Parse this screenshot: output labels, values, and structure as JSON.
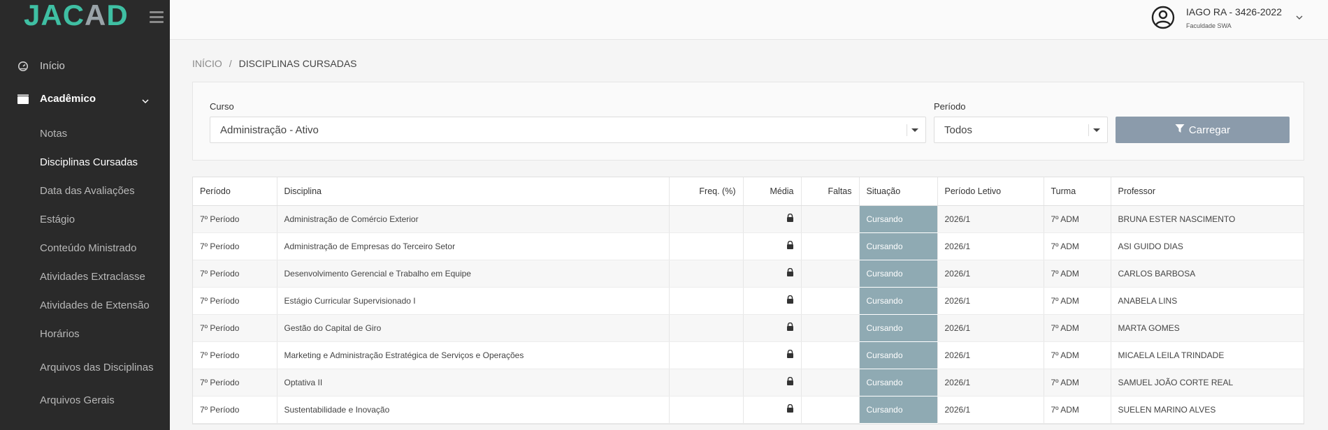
{
  "app": {
    "logo_part1": "JAC",
    "logo_part2": "A",
    "logo_part3": "D"
  },
  "sidebar": {
    "items": [
      {
        "label": "Início",
        "icon": "dashboard-icon"
      },
      {
        "label": "Acadêmico",
        "icon": "folder-icon",
        "expanded": true
      }
    ],
    "sub_items": [
      {
        "label": "Notas"
      },
      {
        "label": "Disciplinas Cursadas",
        "active": true
      },
      {
        "label": "Data das Avaliações"
      },
      {
        "label": "Estágio"
      },
      {
        "label": "Conteúdo Ministrado"
      },
      {
        "label": "Atividades Extraclasse"
      },
      {
        "label": "Atividades de Extensão"
      },
      {
        "label": "Horários"
      },
      {
        "label": "Arquivos das Disciplinas"
      },
      {
        "label": "Arquivos Gerais"
      }
    ]
  },
  "user": {
    "name": "IAGO RA - 3426-2022",
    "faculty": "Faculdade SWA"
  },
  "breadcrumb": {
    "home": "INÍCIO",
    "separator": "/",
    "current": "DISCIPLINAS CURSADAS"
  },
  "filters": {
    "curso_label": "Curso",
    "curso_value": "Administração - Ativo",
    "periodo_label": "Período",
    "periodo_value": "Todos",
    "load_button": "Carregar"
  },
  "table": {
    "headers": [
      "Período",
      "Disciplina",
      "Freq. (%)",
      "Média",
      "Faltas",
      "Situação",
      "Período Letivo",
      "Turma",
      "Professor"
    ],
    "rows": [
      {
        "periodo": "7º Período",
        "disciplina": "Administração de Comércio Exterior",
        "freq": "",
        "faltas": "",
        "situacao": "Cursando",
        "periodo_letivo": "2026/1",
        "turma": "7º ADM",
        "professor": "BRUNA ESTER NASCIMENTO"
      },
      {
        "periodo": "7º Período",
        "disciplina": "Administração de Empresas do Terceiro Setor",
        "freq": "",
        "faltas": "",
        "situacao": "Cursando",
        "periodo_letivo": "2026/1",
        "turma": "7º ADM",
        "professor": "ASI GUIDO DIAS"
      },
      {
        "periodo": "7º Período",
        "disciplina": "Desenvolvimento Gerencial e Trabalho em Equipe",
        "freq": "",
        "faltas": "",
        "situacao": "Cursando",
        "periodo_letivo": "2026/1",
        "turma": "7º ADM",
        "professor": "CARLOS BARBOSA"
      },
      {
        "periodo": "7º Período",
        "disciplina": "Estágio Curricular Supervisionado I",
        "freq": "",
        "faltas": "",
        "situacao": "Cursando",
        "periodo_letivo": "2026/1",
        "turma": "7º ADM",
        "professor": "ANABELA LINS"
      },
      {
        "periodo": "7º Período",
        "disciplina": "Gestão do Capital de Giro",
        "freq": "",
        "faltas": "",
        "situacao": "Cursando",
        "periodo_letivo": "2026/1",
        "turma": "7º ADM",
        "professor": "MARTA GOMES"
      },
      {
        "periodo": "7º Período",
        "disciplina": "Marketing e Administração Estratégica de Serviços e Operações",
        "freq": "",
        "faltas": "",
        "situacao": "Cursando",
        "periodo_letivo": "2026/1",
        "turma": "7º ADM",
        "professor": "MICAELA LEILA TRINDADE"
      },
      {
        "periodo": "7º Período",
        "disciplina": "Optativa II",
        "freq": "",
        "faltas": "",
        "situacao": "Cursando",
        "periodo_letivo": "2026/1",
        "turma": "7º ADM",
        "professor": "SAMUEL JOÃO CORTE REAL"
      },
      {
        "periodo": "7º Período",
        "disciplina": "Sustentabilidade e Inovação",
        "freq": "",
        "faltas": "",
        "situacao": "Cursando",
        "periodo_letivo": "2026/1",
        "turma": "7º ADM",
        "professor": "SUELEN MARINO ALVES"
      }
    ]
  },
  "colors": {
    "sidebar_bg": "#2a2a2a",
    "logo": "#3fbfa3",
    "situacao_bg": "#8faab3",
    "button_bg": "#8b9bab"
  },
  "icons": {
    "media": "lock-icon",
    "load_button": "filter-icon"
  }
}
